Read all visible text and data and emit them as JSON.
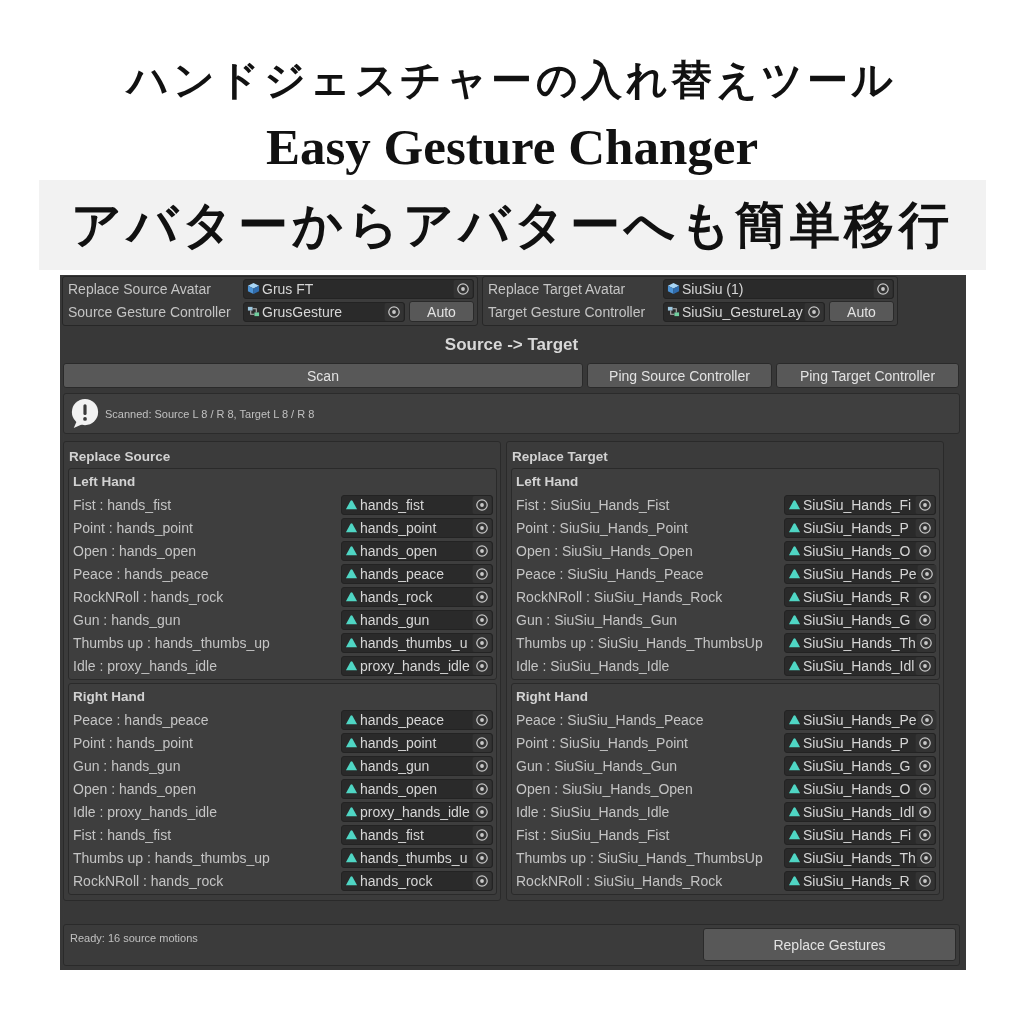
{
  "header": {
    "title": "ハンドジェスチャーの入れ替えツール",
    "subtitle": "Easy Gesture Changer",
    "tagline": "アバターからアバターへも簡単移行"
  },
  "avatar_panels": [
    {
      "avatar_label": "Replace Source Avatar",
      "avatar_value": "Grus FT",
      "controller_label": "Source Gesture Controller",
      "controller_value": "GrusGesture",
      "auto_button": "Auto"
    },
    {
      "avatar_label": "Replace Target Avatar",
      "avatar_value": "SiuSiu (1)",
      "controller_label": "Target Gesture Controller",
      "controller_value": "SiuSiu_GestureLay",
      "auto_button": "Auto"
    }
  ],
  "section_title": "Source -> Target",
  "action_buttons": [
    "Scan",
    "Ping Source Controller",
    "Ping Target Controller"
  ],
  "help_box": {
    "message": "Scanned: Source L 8 / R 8, Target L 8 / R 8"
  },
  "columns": [
    {
      "title": "Replace Source",
      "groups": [
        {
          "title": "Left Hand",
          "rows": [
            {
              "label": "Fist : hands_fist",
              "value": "hands_fist"
            },
            {
              "label": "Point : hands_point",
              "value": "hands_point"
            },
            {
              "label": "Open : hands_open",
              "value": "hands_open"
            },
            {
              "label": "Peace : hands_peace",
              "value": "hands_peace"
            },
            {
              "label": "RockNRoll : hands_rock",
              "value": "hands_rock"
            },
            {
              "label": "Gun : hands_gun",
              "value": "hands_gun"
            },
            {
              "label": "Thumbs up : hands_thumbs_up",
              "value": "hands_thumbs_u"
            },
            {
              "label": "Idle : proxy_hands_idle",
              "value": "proxy_hands_idle"
            }
          ]
        },
        {
          "title": "Right Hand",
          "rows": [
            {
              "label": "Peace : hands_peace",
              "value": "hands_peace"
            },
            {
              "label": "Point : hands_point",
              "value": "hands_point"
            },
            {
              "label": "Gun : hands_gun",
              "value": "hands_gun"
            },
            {
              "label": "Open : hands_open",
              "value": "hands_open"
            },
            {
              "label": "Idle : proxy_hands_idle",
              "value": "proxy_hands_idle"
            },
            {
              "label": "Fist : hands_fist",
              "value": "hands_fist"
            },
            {
              "label": "Thumbs up : hands_thumbs_up",
              "value": "hands_thumbs_u"
            },
            {
              "label": "RockNRoll : hands_rock",
              "value": "hands_rock"
            }
          ]
        }
      ]
    },
    {
      "title": "Replace Target",
      "groups": [
        {
          "title": "Left Hand",
          "rows": [
            {
              "label": "Fist : SiuSiu_Hands_Fist",
              "value": "SiuSiu_Hands_Fi"
            },
            {
              "label": "Point : SiuSiu_Hands_Point",
              "value": "SiuSiu_Hands_P"
            },
            {
              "label": "Open : SiuSiu_Hands_Open",
              "value": "SiuSiu_Hands_O"
            },
            {
              "label": "Peace : SiuSiu_Hands_Peace",
              "value": "SiuSiu_Hands_Pe"
            },
            {
              "label": "RockNRoll : SiuSiu_Hands_Rock",
              "value": "SiuSiu_Hands_R"
            },
            {
              "label": "Gun : SiuSiu_Hands_Gun",
              "value": "SiuSiu_Hands_G"
            },
            {
              "label": "Thumbs up : SiuSiu_Hands_ThumbsUp",
              "value": "SiuSiu_Hands_Th"
            },
            {
              "label": "Idle : SiuSiu_Hands_Idle",
              "value": "SiuSiu_Hands_Idl"
            }
          ]
        },
        {
          "title": "Right Hand",
          "rows": [
            {
              "label": "Peace : SiuSiu_Hands_Peace",
              "value": "SiuSiu_Hands_Pe"
            },
            {
              "label": "Point : SiuSiu_Hands_Point",
              "value": "SiuSiu_Hands_P"
            },
            {
              "label": "Gun : SiuSiu_Hands_Gun",
              "value": "SiuSiu_Hands_G"
            },
            {
              "label": "Open : SiuSiu_Hands_Open",
              "value": "SiuSiu_Hands_O"
            },
            {
              "label": "Idle : SiuSiu_Hands_Idle",
              "value": "SiuSiu_Hands_Idl"
            },
            {
              "label": "Fist : SiuSiu_Hands_Fist",
              "value": "SiuSiu_Hands_Fi"
            },
            {
              "label": "Thumbs up : SiuSiu_Hands_ThumbsUp",
              "value": "SiuSiu_Hands_Th"
            },
            {
              "label": "RockNRoll : SiuSiu_Hands_Rock",
              "value": "SiuSiu_Hands_R"
            }
          ]
        }
      ]
    }
  ],
  "status_bar": {
    "text": "Ready: 16 source motions",
    "button": "Replace Gestures"
  }
}
